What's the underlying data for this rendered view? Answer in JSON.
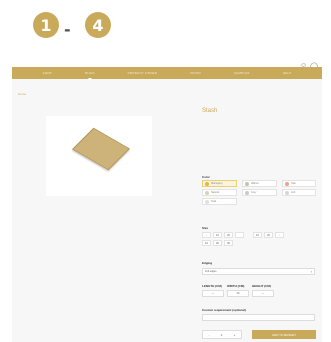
{
  "steps": {
    "first": "1",
    "separator": "-",
    "last": "4"
  },
  "header": {
    "icons": [
      "user-icon",
      "bag-icon"
    ]
  },
  "nav": {
    "items": [
      {
        "label": "SHOP"
      },
      {
        "label": "RUGS"
      },
      {
        "label": "PRODUCT FINDER"
      },
      {
        "label": "WOOD"
      },
      {
        "label": "SAMPLES"
      },
      {
        "label": "HELP"
      }
    ],
    "active_index": 1
  },
  "breadcrumb": "Home",
  "product": {
    "title": "Stash"
  },
  "color_section": {
    "label": "Color",
    "options": [
      {
        "label": "Mahogany",
        "color": "#e2b93b"
      },
      {
        "label": "Walnut",
        "color": "#c8c0b0"
      },
      {
        "label": "Oak",
        "color": "#e9a48c"
      },
      {
        "label": "Natural",
        "color": "#d8d0c0"
      },
      {
        "label": "Grey",
        "color": "#c9c9c9"
      },
      {
        "label": "Ash",
        "color": "#d6d6d6"
      },
      {
        "label": "Teak",
        "color": "#e0e0e0"
      }
    ],
    "selected_index": 0
  },
  "size_section": {
    "label": "Size",
    "row1": [
      "-",
      "10",
      "20",
      "",
      "10",
      "20",
      "-"
    ],
    "row2": [
      "10",
      "20",
      "30"
    ]
  },
  "edging": {
    "label": "Edging",
    "value": "Full edges"
  },
  "dimensions": {
    "labels": [
      "LENGTH (CM)",
      "WIDTH (CM)",
      "HEIGHT (CM)"
    ],
    "values": [
      "—",
      "10",
      "—"
    ]
  },
  "custom": {
    "label": "Custom requirement (optional)",
    "placeholder": ""
  },
  "quantity": {
    "minus": "-",
    "value": "1",
    "plus": "+"
  },
  "cart": {
    "label": "ADD TO BASKET"
  }
}
